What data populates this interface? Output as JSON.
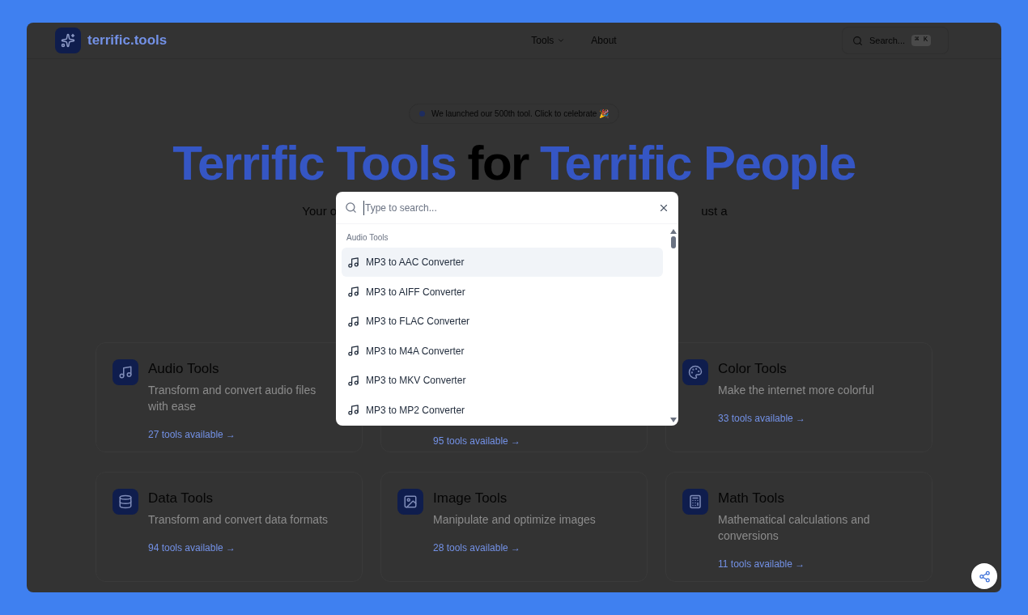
{
  "header": {
    "logo": "terrific.tools",
    "nav": [
      {
        "label": "Tools",
        "dropdown": true
      },
      {
        "label": "About",
        "dropdown": false
      }
    ],
    "search": {
      "placeholder": "Search...",
      "shortcut": "⌘ K"
    }
  },
  "badge": "We launched our 500th tool. Click to celebrate 🎉",
  "heading": [
    {
      "text": "Terrific Tools",
      "accent": true
    },
    {
      "text": "for",
      "accent": false
    },
    {
      "text": "Terrific People",
      "accent": true
    }
  ],
  "subtitle": {
    "left": "Your o",
    "right": "ust a"
  },
  "cards": [
    {
      "kind": "audio",
      "title": "Audio Tools",
      "description": "Transform and convert audio files with ease",
      "link": "27 tools available →"
    },
    {
      "kind": "hidden",
      "link": "95 tools available →"
    },
    {
      "kind": "color",
      "title": "Color Tools",
      "description": "Make the internet more colorful",
      "link": "33 tools available →"
    },
    {
      "kind": "data",
      "title": "Data Tools",
      "description": "Transform and convert data formats",
      "link": "94 tools available →"
    },
    {
      "kind": "image",
      "title": "Image Tools",
      "description": "Manipulate and optimize images",
      "link": "28 tools available →"
    },
    {
      "kind": "math",
      "title": "Math Tools",
      "description": "Mathematical calculations and conversions",
      "link": "11 tools available →"
    }
  ],
  "command_palette": {
    "placeholder": "Type to search...",
    "group": "Audio Tools",
    "items": [
      {
        "label": "MP3 to AAC Converter",
        "selected": true
      },
      {
        "label": "MP3 to AIFF Converter",
        "selected": false
      },
      {
        "label": "MP3 to FLAC Converter",
        "selected": false
      },
      {
        "label": "MP3 to M4A Converter",
        "selected": false
      },
      {
        "label": "MP3 to MKV Converter",
        "selected": false
      },
      {
        "label": "MP3 to MP2 Converter",
        "selected": false
      }
    ]
  }
}
